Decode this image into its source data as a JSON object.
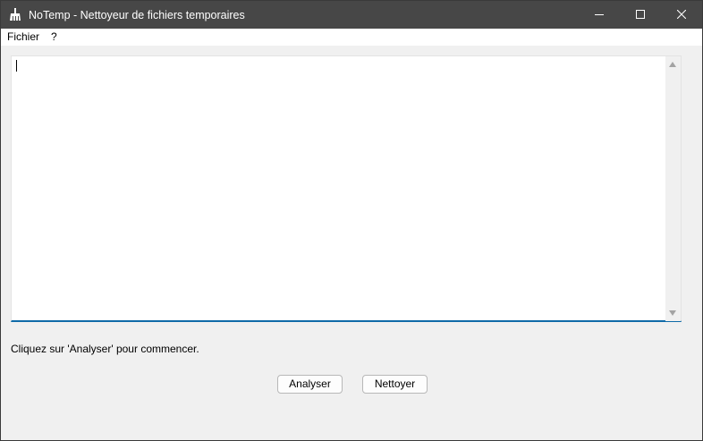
{
  "window": {
    "title": "NoTemp - Nettoyeur de fichiers temporaires",
    "app_icon": "broom-icon",
    "controls": [
      "minimize-icon",
      "maximize-icon",
      "close-icon"
    ]
  },
  "menubar": {
    "items": [
      {
        "label": "Fichier"
      },
      {
        "label": "?"
      }
    ]
  },
  "log_area": {
    "value": ""
  },
  "status": {
    "text": "Cliquez sur 'Analyser' pour commencer."
  },
  "actions": {
    "analyse_label": "Analyser",
    "clean_label": "Nettoyer"
  },
  "colors": {
    "titlebar": "#474747",
    "accent": "#0f6aa8",
    "window_bg": "#f0f0f0"
  }
}
